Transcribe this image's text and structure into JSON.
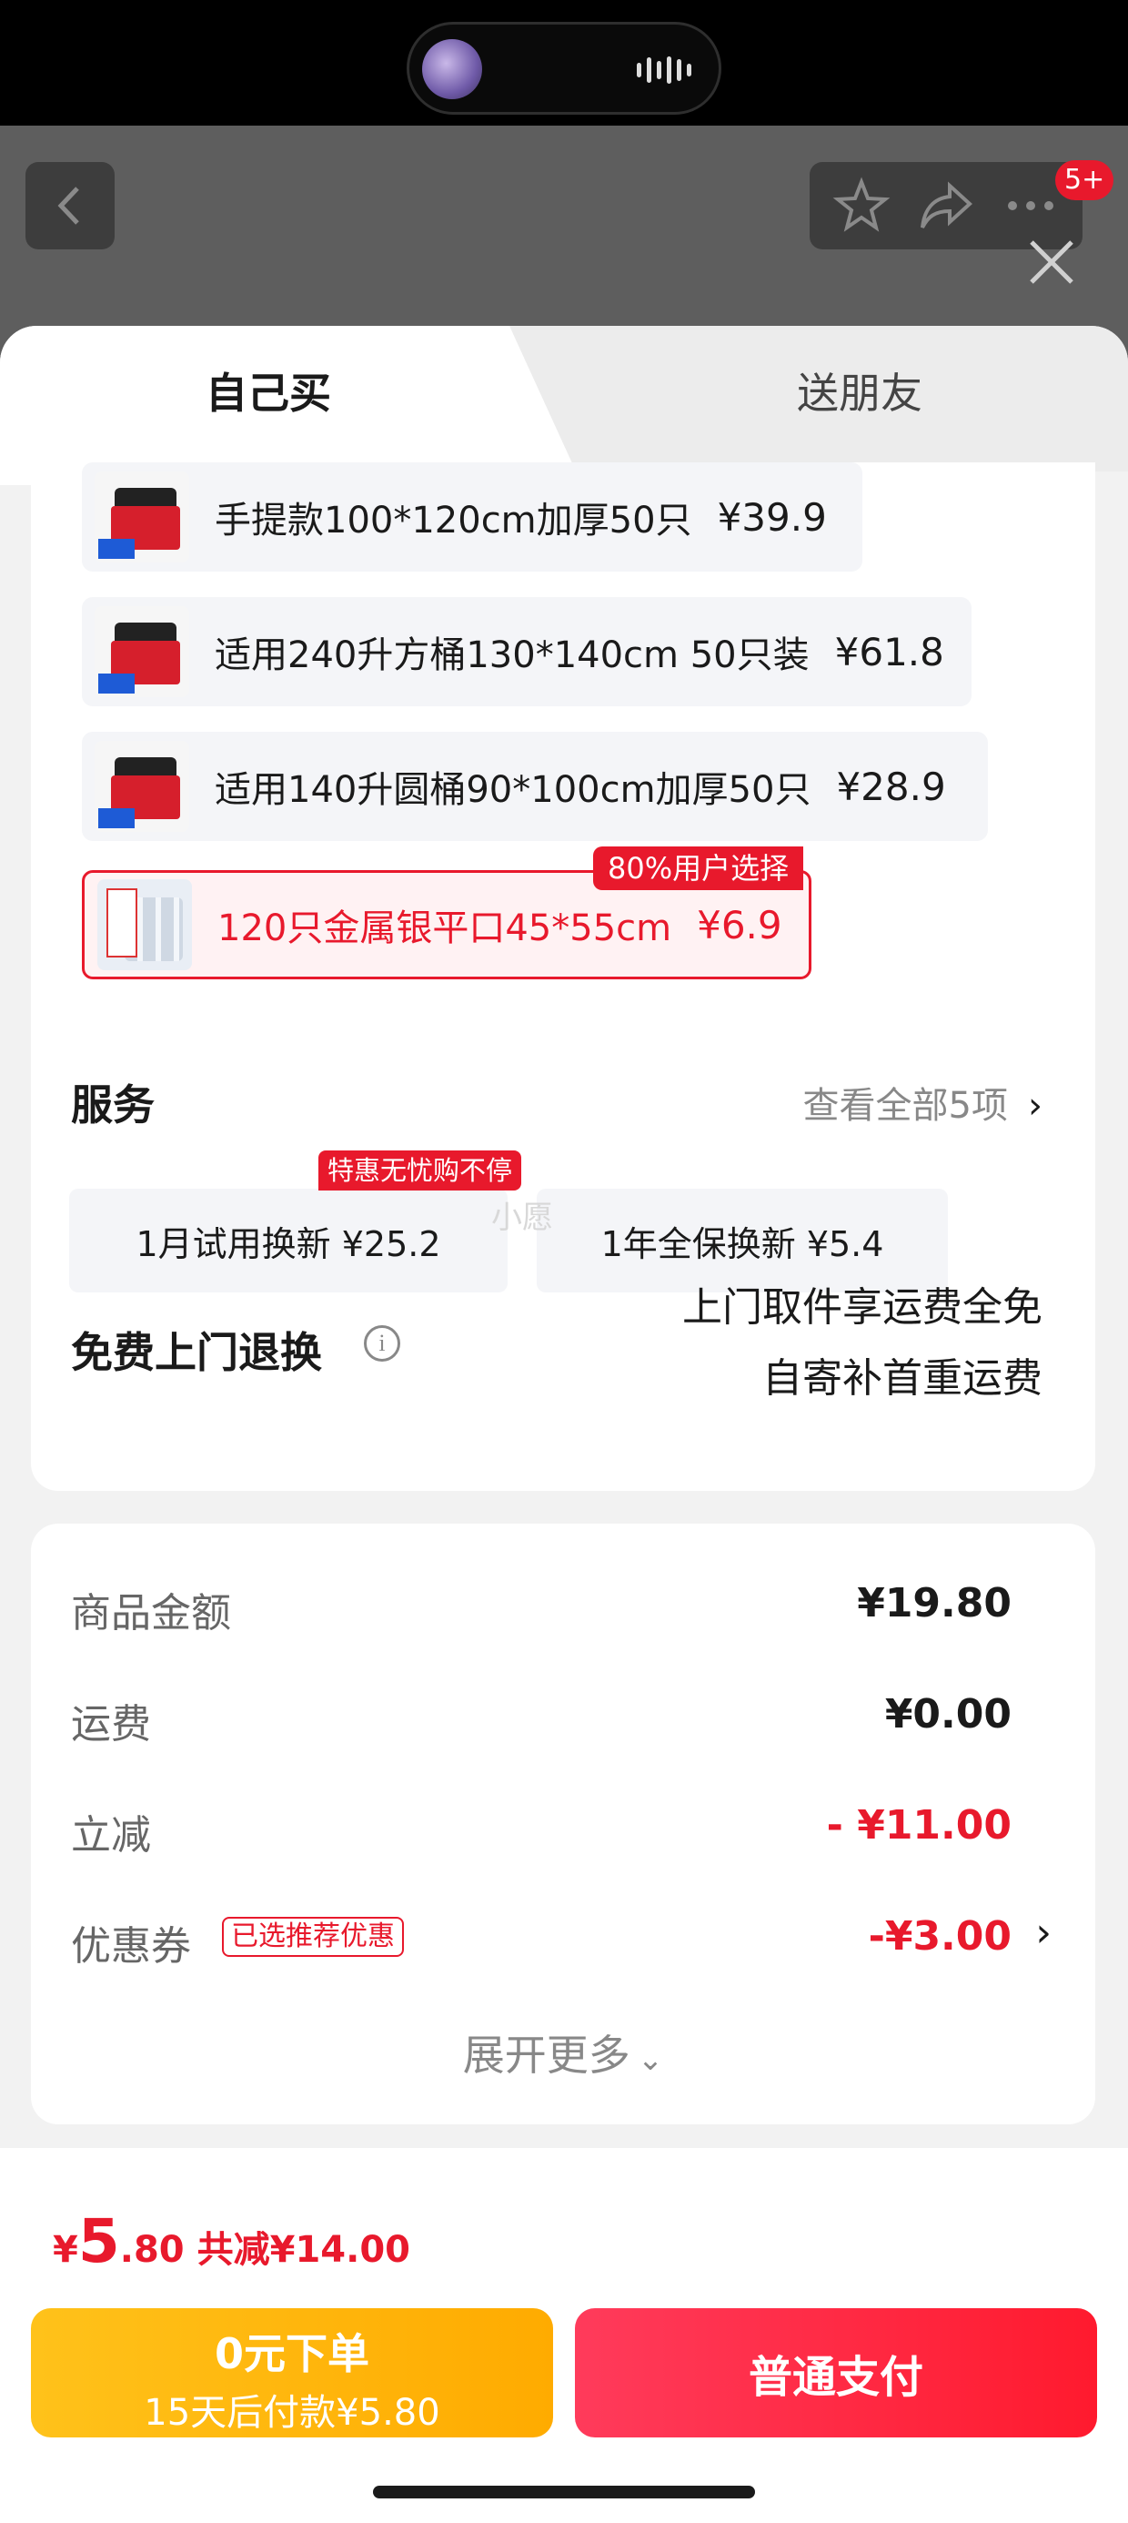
{
  "header": {
    "cart_badge": "5+"
  },
  "tabs": {
    "self_buy": "自己买",
    "gift_friend": "送朋友"
  },
  "skus": [
    {
      "label": "手提款100*120cm加厚50只",
      "price": "¥39.9"
    },
    {
      "label": "适用240升方桶130*140cm 50只装",
      "price": "¥61.8"
    },
    {
      "label": "适用140升圆桶90*100cm加厚50只",
      "price": "¥28.9"
    },
    {
      "label": "120只金属银平口45*55cm",
      "price": "¥6.9",
      "badge": "80%用户选择"
    }
  ],
  "services": {
    "title": "服务",
    "view_all": "查看全部5项",
    "chips": [
      {
        "label": "1月试用换新  ¥25.2",
        "tag": "特惠无忧购不停"
      },
      {
        "label": "1年全保换新  ¥5.4"
      }
    ]
  },
  "free_return": {
    "title": "免费上门退换",
    "line1": "上门取件享运费全免",
    "line2": "自寄补首重运费"
  },
  "summary": {
    "goods_label": "商品金额",
    "goods_value": "¥19.80",
    "shipping_label": "运费",
    "shipping_value": "¥0.00",
    "discount_label": "立减",
    "discount_value": "- ¥11.00",
    "coupon_label": "优惠券",
    "coupon_badge": "已选推荐优惠",
    "coupon_value": "-¥3.00",
    "expand": "展开更多"
  },
  "footer": {
    "currency": "¥",
    "total_int": "5",
    "total_dec": ".80",
    "saved": "共减¥14.00",
    "zero_btn_line1": "0元下单",
    "zero_btn_line2": "15天后付款¥5.80",
    "pay_btn": "普通支付"
  },
  "watermark": "小愿",
  "colors": {
    "accent_red": "#e8192c",
    "yellow": "#ffb800"
  }
}
